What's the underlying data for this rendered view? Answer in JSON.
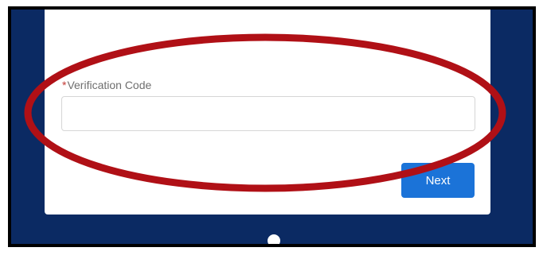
{
  "form": {
    "required_marker": "*",
    "verification_label": "Verification Code",
    "verification_value": "",
    "next_label": "Next"
  },
  "colors": {
    "background_panel": "#0b2a63",
    "primary_button": "#1b73d8",
    "annotation_ellipse": "#b01016"
  }
}
